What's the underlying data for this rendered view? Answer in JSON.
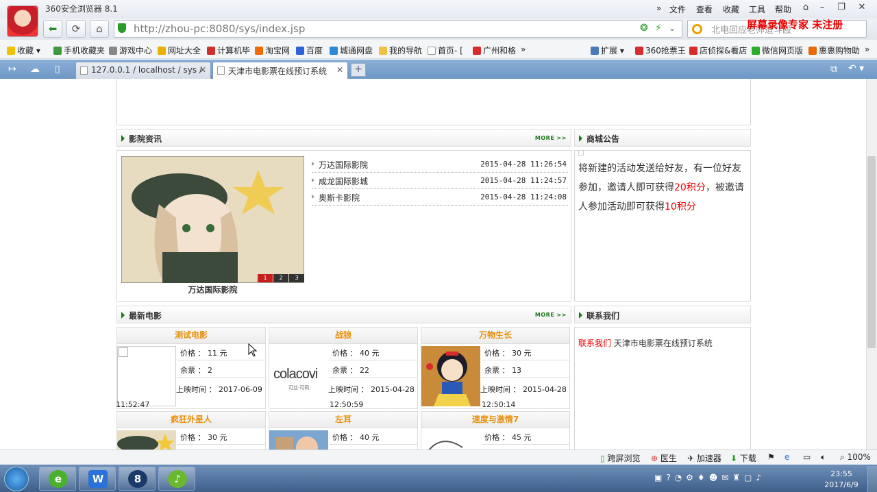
{
  "browser": {
    "title": "360安全浏览器 8.1",
    "menu": [
      "文件",
      "查看",
      "收藏",
      "工具",
      "帮助"
    ],
    "url": "http://zhou-pc:8080/sys/index.jsp",
    "search_text": "北电回应老师遭斗殴",
    "watermark": "屏幕录像专家 未注册",
    "bookmarks": [
      "收藏",
      "手机收藏夹",
      "游戏中心",
      "网址大全",
      "计算机毕",
      "淘宝网",
      "百度",
      "城通网盘",
      "我的导航",
      "首页-",
      "广州和格"
    ],
    "bookmarks_right": [
      "扩展",
      "360抢票王",
      "店侦探&看店",
      "微信网页版",
      "惠惠购物助"
    ],
    "tabs": [
      {
        "label": "127.0.0.1 / localhost / sys /",
        "close": "✕"
      },
      {
        "label": "天津市电影票在线预订系统",
        "close": "✕"
      }
    ],
    "new_tab": "+"
  },
  "page": {
    "news": {
      "header": "影院资讯",
      "more": "MORE >>",
      "caption": "万达国际影院",
      "slider_nums": [
        "1",
        "2",
        "3"
      ],
      "items": [
        {
          "title": "万达国际影院",
          "date": "2015-04-28 11:26:54"
        },
        {
          "title": "成龙国际影城",
          "date": "2015-04-28 11:24:57"
        },
        {
          "title": "奥斯卡影院",
          "date": "2015-04-28 11:24:08"
        }
      ]
    },
    "notice": {
      "header": "商城公告",
      "text1": "将新建的活动发送给好友，有一位好友参加，邀请人即可获得",
      "pts1": "20积分",
      "text2": "，被邀请人参加活动即可获得",
      "pts2": "10积分"
    },
    "movies_header": "最新电影",
    "movies_more": "MORE >>",
    "labels": {
      "price": "价格 ：",
      "yuan": "元",
      "remain": "余票 ：",
      "time": "上映时间 ："
    },
    "movies": [
      {
        "title": "测试电影",
        "price": "11",
        "remain": "2",
        "date": "2017-06-09",
        "time": "11:52:47"
      },
      {
        "title": "战狼",
        "price": "40",
        "remain": "22",
        "date": "2015-04-28",
        "time": "12:50:59",
        "logo": "colacovi",
        "logo_sub": "可丝·可莉"
      },
      {
        "title": "万物生长",
        "price": "30",
        "remain": "13",
        "date": "2015-04-28",
        "time": "12:50:14"
      },
      {
        "title": "疯狂外星人",
        "price": "30"
      },
      {
        "title": "左耳",
        "price": "40"
      },
      {
        "title": "速度与激情7",
        "price": "45"
      }
    ],
    "contact": {
      "header": "联系我们",
      "label": "联系我们",
      "text": "天津市电影票在线预订系统"
    }
  },
  "status": {
    "items": [
      "跨屏浏览",
      "医生",
      "加速器",
      "下载"
    ],
    "zoom": "100%"
  },
  "clock": {
    "time": "23:55",
    "date": "2017/6/9"
  }
}
